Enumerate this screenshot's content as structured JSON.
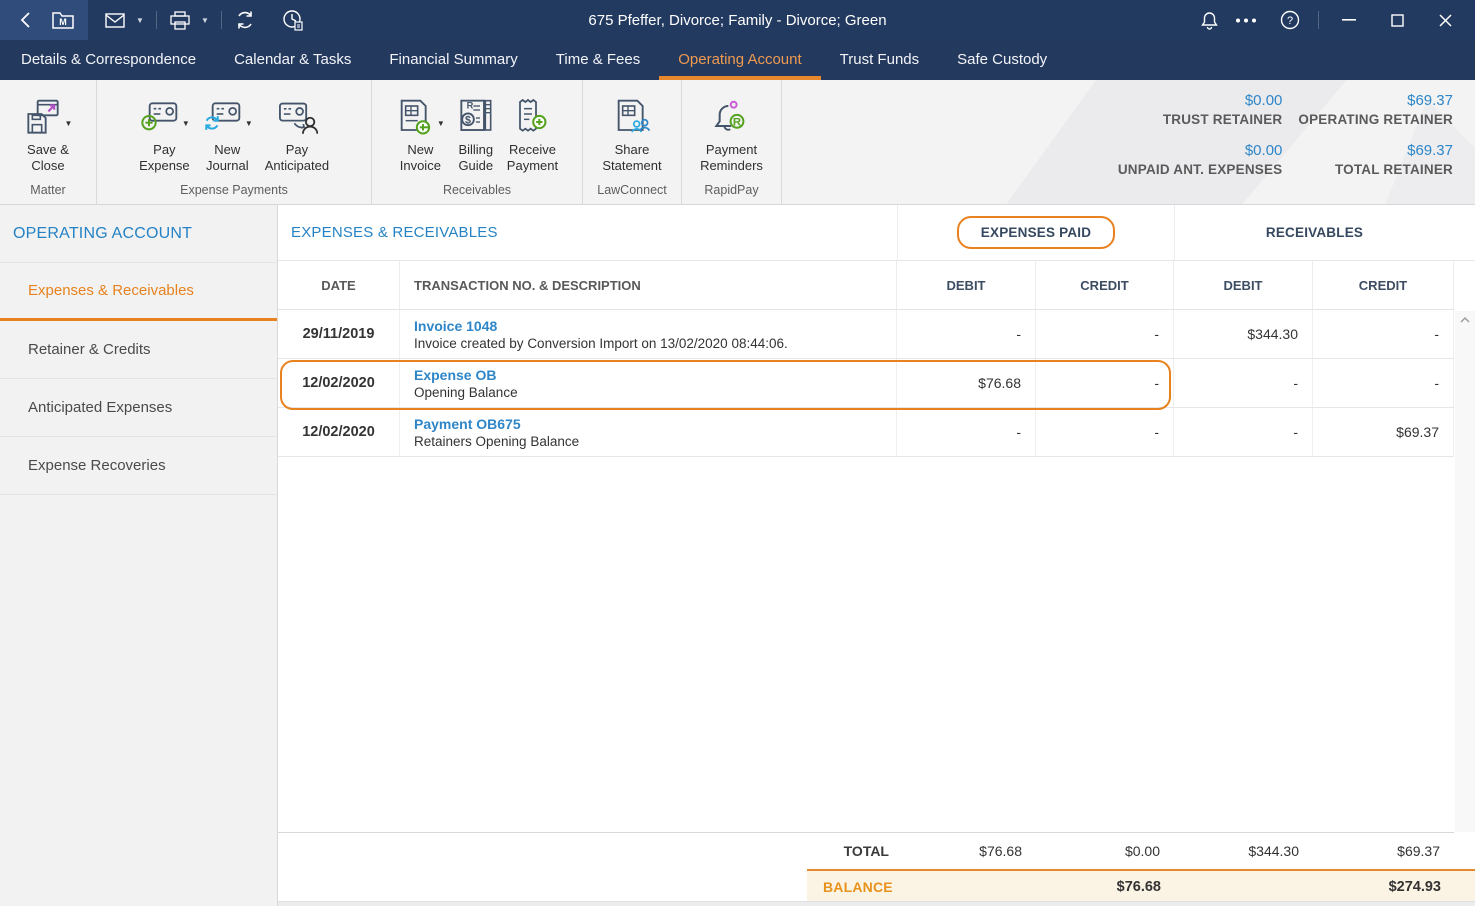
{
  "window": {
    "title": "675 Pfeffer, Divorce; Family - Divorce; Green",
    "icons": [
      "back-icon",
      "matter-folder-icon",
      "mail-icon",
      "print-icon",
      "sync-icon",
      "time-icon",
      "notifications-bell-icon",
      "more-ellipsis-icon",
      "help-icon",
      "minimize-icon",
      "maximize-icon",
      "close-icon"
    ]
  },
  "tabs": {
    "items": [
      {
        "label": "Details & Correspondence"
      },
      {
        "label": "Calendar & Tasks"
      },
      {
        "label": "Financial Summary"
      },
      {
        "label": "Time & Fees"
      },
      {
        "label": "Operating Account",
        "active": true
      },
      {
        "label": "Trust Funds"
      },
      {
        "label": "Safe Custody"
      }
    ]
  },
  "ribbon": {
    "groups": [
      {
        "caption": "Matter",
        "buttons": [
          {
            "label": "Save &\nClose",
            "icon": "save-close-icon",
            "dropdown": true
          }
        ]
      },
      {
        "caption": "Expense Payments",
        "buttons": [
          {
            "label": "Pay\nExpense",
            "icon": "pay-expense-icon",
            "dropdown": true
          },
          {
            "label": "New\nJournal",
            "icon": "new-journal-icon",
            "dropdown": true
          },
          {
            "label": "Pay\nAnticipated",
            "icon": "pay-anticipated-icon",
            "dropdown": false
          }
        ]
      },
      {
        "caption": "Receivables",
        "buttons": [
          {
            "label": "New\nInvoice",
            "icon": "new-invoice-icon",
            "dropdown": true
          },
          {
            "label": "Billing\nGuide",
            "icon": "billing-guide-icon",
            "dropdown": false
          },
          {
            "label": "Receive\nPayment",
            "icon": "receive-payment-icon",
            "dropdown": false
          }
        ]
      },
      {
        "caption": "LawConnect",
        "buttons": [
          {
            "label": "Share\nStatement",
            "icon": "share-statement-icon",
            "dropdown": false
          }
        ]
      },
      {
        "caption": "RapidPay",
        "buttons": [
          {
            "label": "Payment\nReminders",
            "icon": "payment-reminders-icon",
            "dropdown": false
          }
        ]
      }
    ],
    "retainer": {
      "items": [
        {
          "value": "$0.00",
          "label": "TRUST RETAINER"
        },
        {
          "value": "$69.37",
          "label": "OPERATING RETAINER"
        },
        {
          "value": "$0.00",
          "label": "UNPAID ANT. EXPENSES"
        },
        {
          "value": "$69.37",
          "label": "TOTAL RETAINER"
        }
      ]
    }
  },
  "sidebar": {
    "heading": "OPERATING ACCOUNT",
    "items": [
      {
        "label": "Expenses & Receivables",
        "active": true
      },
      {
        "label": "Retainer & Credits"
      },
      {
        "label": "Anticipated Expenses"
      },
      {
        "label": "Expense Recoveries"
      }
    ]
  },
  "main": {
    "title": "EXPENSES & RECEIVABLES",
    "groups": {
      "expenses_paid": "EXPENSES PAID",
      "receivables": "RECEIVABLES"
    },
    "columns": [
      "DATE",
      "TRANSACTION NO. & DESCRIPTION",
      "DEBIT",
      "CREDIT",
      "DEBIT",
      "CREDIT"
    ],
    "rows": [
      {
        "date": "29/11/2019",
        "ref": "Invoice 1048",
        "desc": "Invoice created by Conversion Import on 13/02/2020 08:44:06.",
        "ep_debit": "-",
        "ep_credit": "-",
        "rc_debit": "$344.30",
        "rc_credit": "-"
      },
      {
        "date": "12/02/2020",
        "ref": "Expense OB",
        "desc": "Opening Balance",
        "ep_debit": "$76.68",
        "ep_credit": "-",
        "rc_debit": "-",
        "rc_credit": "-",
        "highlighted": true
      },
      {
        "date": "12/02/2020",
        "ref": "Payment OB675",
        "desc": "Retainers Opening Balance",
        "ep_debit": "-",
        "ep_credit": "-",
        "rc_debit": "-",
        "rc_credit": "$69.37"
      }
    ],
    "total": {
      "label": "TOTAL",
      "ep_debit": "$76.68",
      "ep_credit": "$0.00",
      "rc_debit": "$344.30",
      "rc_credit": "$69.37"
    },
    "balance": {
      "label": "BALANCE",
      "expenses": "$76.68",
      "receivables": "$274.93"
    }
  },
  "colors": {
    "accent_orange": "#E8821E",
    "titlebar_navy": "#233A60",
    "link_blue": "#2E86C8",
    "heading_blue": "#2583C5",
    "balance_bg": "#FBF3E4"
  }
}
